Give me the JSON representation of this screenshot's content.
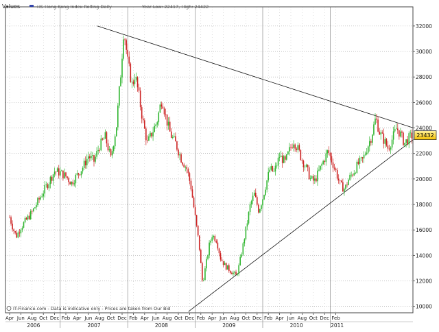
{
  "chart_data": {
    "type": "candlestick",
    "header": {
      "values_label": "Values",
      "series_name": "HS Hong Kong Index Rolling Daily",
      "stats_text": "Year Low: 22417,  High: 24422"
    },
    "footer_note": "IT-Finance.com - Data is indicative only - Prices are taken from Our Bid",
    "last_price_label": "23432",
    "last_price": 23432,
    "ylim": [
      9500,
      33500
    ],
    "y_ticks": [
      10000,
      12000,
      14000,
      16000,
      18000,
      20000,
      22000,
      24000,
      26000,
      28000,
      30000,
      32000
    ],
    "y_tick_labels": [
      "10000",
      "12000",
      "14000",
      "16000",
      "18000",
      "20000",
      "22000",
      "24000",
      "26000",
      "28000",
      "30000",
      "32000"
    ],
    "x_months": [
      "Apr",
      "Jun",
      "Aug",
      "Oct",
      "Dec",
      "Feb",
      "Apr",
      "Jun",
      "Aug",
      "Oct",
      "Dec",
      "Feb",
      "Apr",
      "Jun",
      "Aug",
      "Oct",
      "Dec",
      "Feb",
      "Apr",
      "Jun",
      "Aug",
      "Oct",
      "Dec",
      "Feb",
      "Apr",
      "Jun",
      "Aug",
      "Oct",
      "Dec",
      "Feb"
    ],
    "x_years": [
      "2006",
      "2007",
      "2008",
      "2009",
      "2010",
      "2011"
    ],
    "price_path": [
      [
        0,
        17000
      ],
      [
        0.7,
        16000
      ],
      [
        1.2,
        15500
      ],
      [
        2,
        16200
      ],
      [
        3,
        16800
      ],
      [
        4,
        17400
      ],
      [
        5,
        18200
      ],
      [
        6,
        19000
      ],
      [
        7,
        19800
      ],
      [
        8,
        20600
      ],
      [
        9,
        20500
      ],
      [
        10,
        20200
      ],
      [
        11,
        19700
      ],
      [
        12,
        20300
      ],
      [
        13,
        20900
      ],
      [
        14,
        21800
      ],
      [
        15,
        21400
      ],
      [
        16,
        22600
      ],
      [
        17,
        23300
      ],
      [
        18,
        21600
      ],
      [
        19,
        24200
      ],
      [
        19.8,
        28500
      ],
      [
        20.3,
        31800
      ],
      [
        21,
        29200
      ],
      [
        21.8,
        27300
      ],
      [
        22.3,
        28200
      ],
      [
        23,
        26500
      ],
      [
        23.7,
        24500
      ],
      [
        24.5,
        22800
      ],
      [
        25.3,
        23600
      ],
      [
        26.2,
        24500
      ],
      [
        26.8,
        25800
      ],
      [
        27.1,
        26300
      ],
      [
        27.8,
        24800
      ],
      [
        28.6,
        23500
      ],
      [
        29.5,
        22800
      ],
      [
        30.5,
        21600
      ],
      [
        31.5,
        20800
      ],
      [
        32.2,
        19500
      ],
      [
        33,
        17000
      ],
      [
        33.7,
        14800
      ],
      [
        34.3,
        11800
      ],
      [
        35,
        13500
      ],
      [
        35.5,
        14800
      ],
      [
        36,
        15600
      ],
      [
        36.8,
        15200
      ],
      [
        37.5,
        13800
      ],
      [
        38.3,
        13200
      ],
      [
        39,
        12900
      ],
      [
        39.8,
        12600
      ],
      [
        40.3,
        12400
      ],
      [
        40.8,
        13200
      ],
      [
        41.5,
        14800
      ],
      [
        42.2,
        16500
      ],
      [
        42.8,
        18000
      ],
      [
        43.5,
        18800
      ],
      [
        44.3,
        17500
      ],
      [
        45,
        18500
      ],
      [
        45.7,
        19800
      ],
      [
        46.3,
        20800
      ],
      [
        47,
        20500
      ],
      [
        48,
        21800
      ],
      [
        49,
        21300
      ],
      [
        49.8,
        22300
      ],
      [
        50.5,
        23000
      ],
      [
        51.3,
        22300
      ],
      [
        52,
        21500
      ],
      [
        52.8,
        20800
      ],
      [
        53.5,
        20000
      ],
      [
        54.2,
        19800
      ],
      [
        55,
        20600
      ],
      [
        55.8,
        21400
      ],
      [
        56.6,
        22200
      ],
      [
        57.3,
        21400
      ],
      [
        58,
        20600
      ],
      [
        58.8,
        19500
      ],
      [
        59.6,
        19200
      ],
      [
        60.3,
        20000
      ],
      [
        61.2,
        20600
      ],
      [
        62,
        21200
      ],
      [
        62.8,
        21500
      ],
      [
        63.6,
        22500
      ],
      [
        64.3,
        23300
      ],
      [
        65.1,
        24800
      ],
      [
        65.8,
        23600
      ],
      [
        66.6,
        23000
      ],
      [
        67.3,
        22400
      ],
      [
        68,
        23100
      ],
      [
        68.8,
        24000
      ],
      [
        69.5,
        23500
      ],
      [
        70.2,
        22800
      ],
      [
        71,
        23200
      ],
      [
        71.6,
        23432
      ]
    ],
    "resistance_line": {
      "x": [
        15.6,
        71.8
      ],
      "y": [
        32000,
        24000
      ]
    },
    "support_line": {
      "x": [
        31.8,
        71.8
      ],
      "y": [
        9600,
        23100
      ]
    }
  }
}
